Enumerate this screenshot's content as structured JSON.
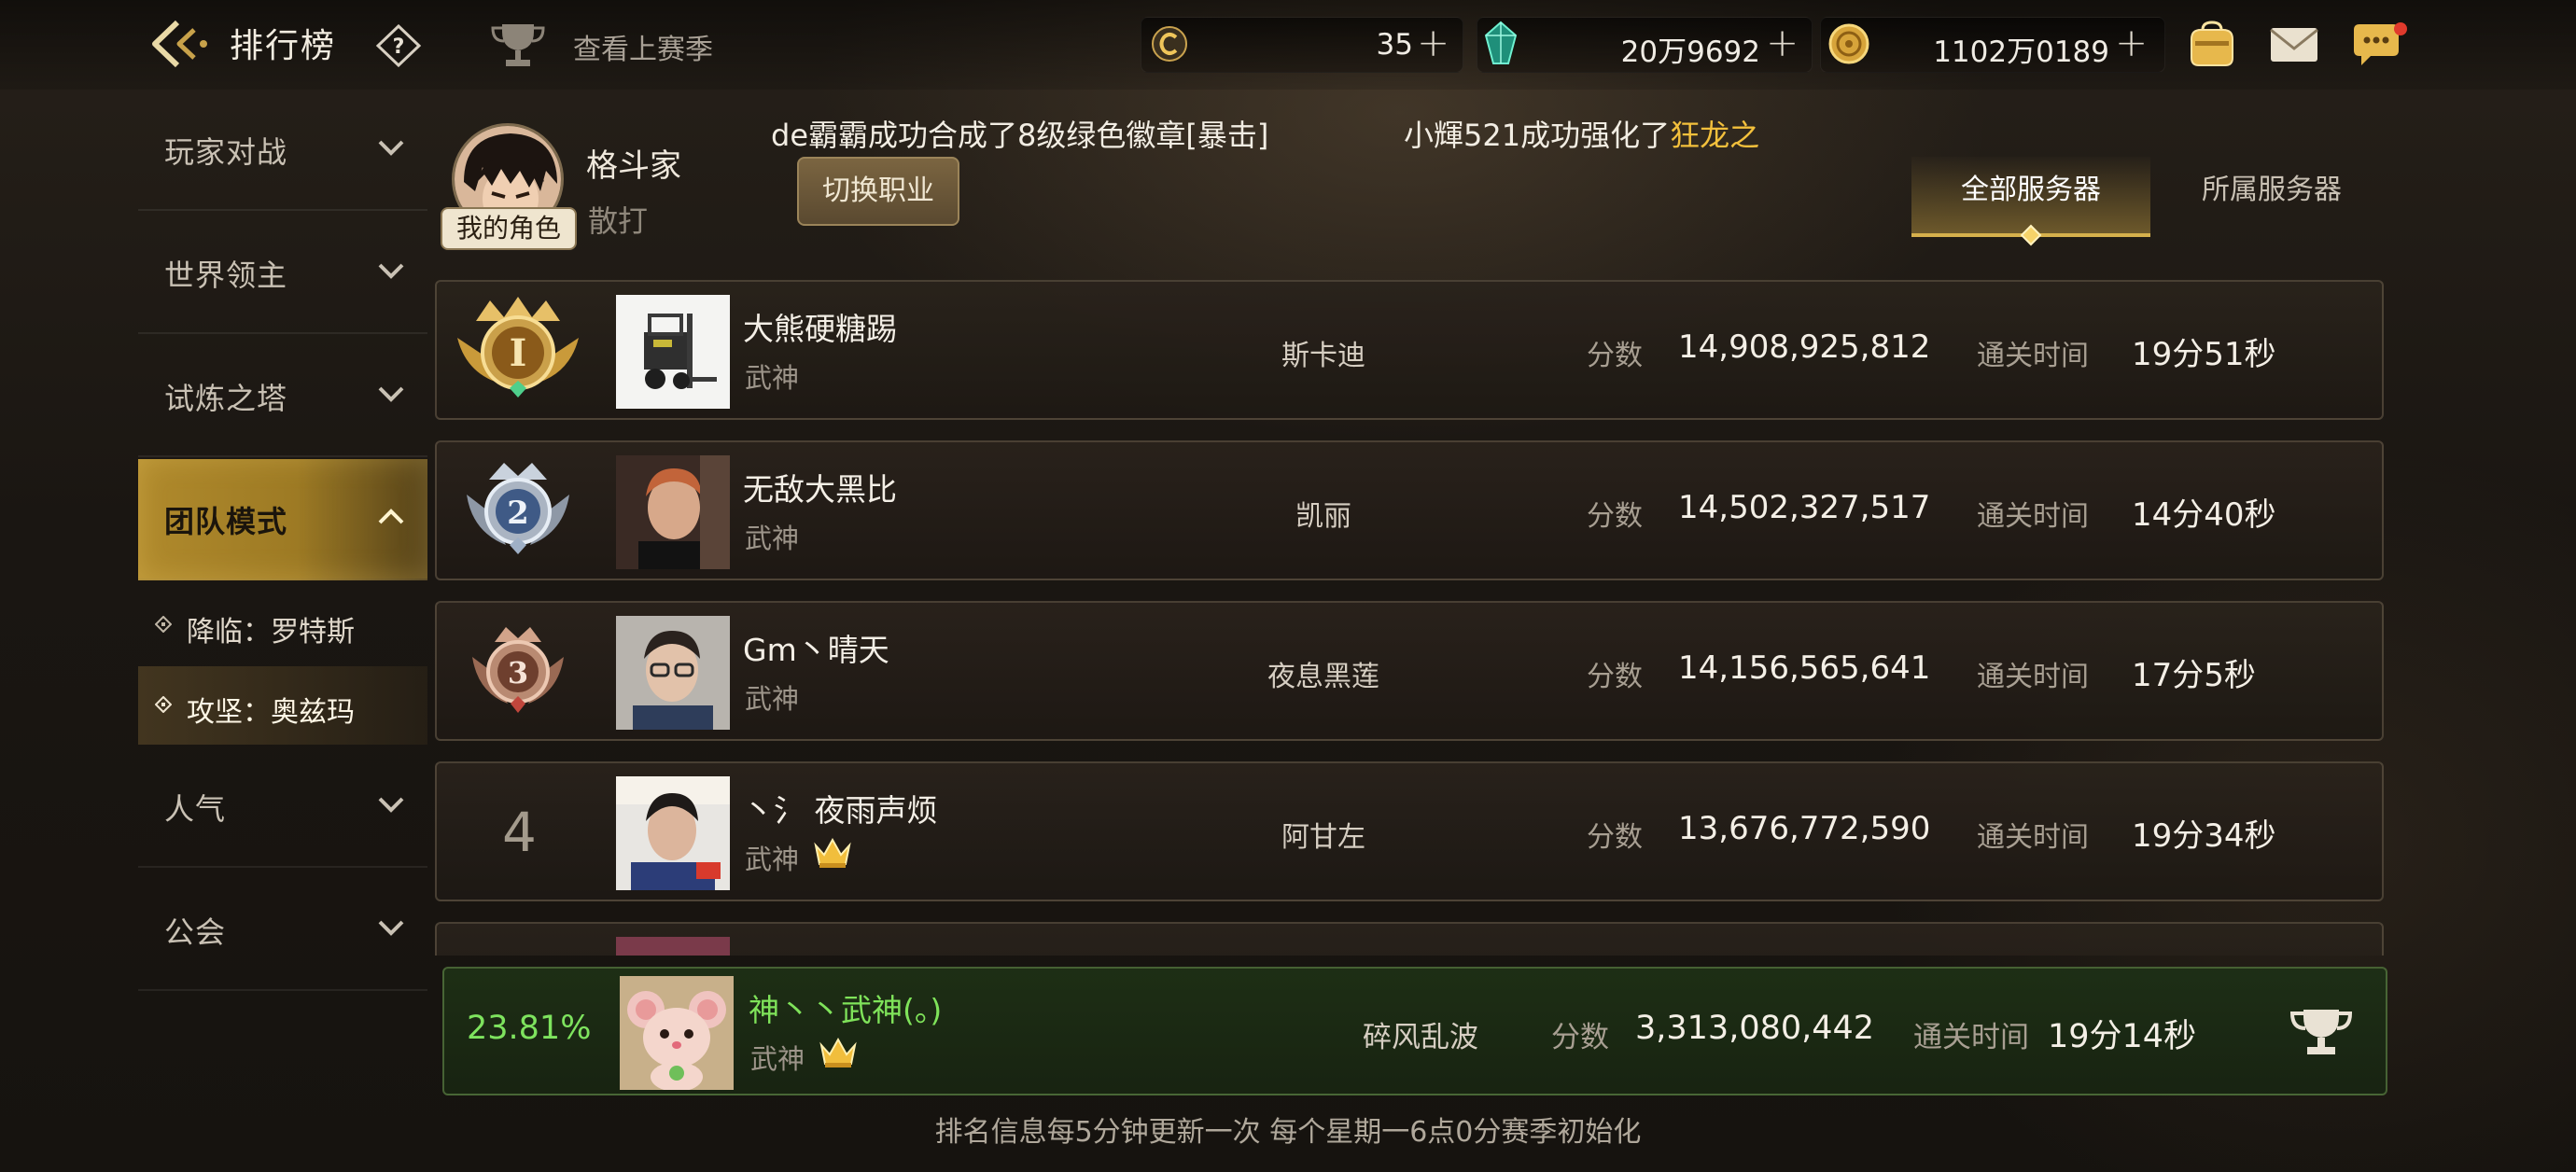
{
  "header": {
    "title": "排行榜",
    "last_season": "查看上赛季"
  },
  "currency": [
    {
      "icon": "c-coin-icon",
      "value": "35"
    },
    {
      "icon": "green-gem-icon",
      "value": "20万9692"
    },
    {
      "icon": "gold-coin-icon",
      "value": "1102万0189"
    }
  ],
  "sidebar": {
    "items": [
      {
        "label": "玩家对战"
      },
      {
        "label": "世界领主"
      },
      {
        "label": "试炼之塔"
      },
      {
        "label": "团队模式"
      },
      {
        "label": "人气"
      },
      {
        "label": "公会"
      }
    ],
    "sub_items": [
      {
        "label": "降临：罗特斯"
      },
      {
        "label": "攻坚：奥兹玛"
      }
    ]
  },
  "player": {
    "name": "格斗家",
    "class": "散打",
    "badge": "我的角色",
    "switch_label": "切换职业"
  },
  "ticker": {
    "msg1": "de霸霸成功合成了8级绿色徽章[暴击]",
    "msg2_prefix": "小輝521成功强化了",
    "msg2_highlight": "狂龙之"
  },
  "tabs": [
    {
      "label": "全部服务器"
    },
    {
      "label": "所属服务器"
    }
  ],
  "labels": {
    "score": "分数",
    "time": "通关时间"
  },
  "rows": [
    {
      "rank": "1",
      "name": "大熊硬糖踢",
      "class": "武神",
      "server": "斯卡迪",
      "score": "14,908,925,812",
      "time": "19分51秒"
    },
    {
      "rank": "2",
      "name": "无敌大黑比",
      "class": "武神",
      "server": "凯丽",
      "score": "14,502,327,517",
      "time": "14分40秒"
    },
    {
      "rank": "3",
      "name": "Gm丶晴天",
      "class": "武神",
      "server": "夜息黑莲",
      "score": "14,156,565,641",
      "time": "17分5秒"
    },
    {
      "rank": "4",
      "name": "丶氵 夜雨声烦",
      "class": "武神",
      "server": "阿甘左",
      "score": "13,676,772,590",
      "time": "19分34秒"
    }
  ],
  "my_rank": {
    "percent": "23.81%",
    "name": "神丶丶武神(。)",
    "class": "武神",
    "server": "碎风乱波",
    "score": "3,313,080,442",
    "time": "19分14秒"
  },
  "footer": "排名信息每5分钟更新一次 每个星期一6点0分赛季初始化"
}
